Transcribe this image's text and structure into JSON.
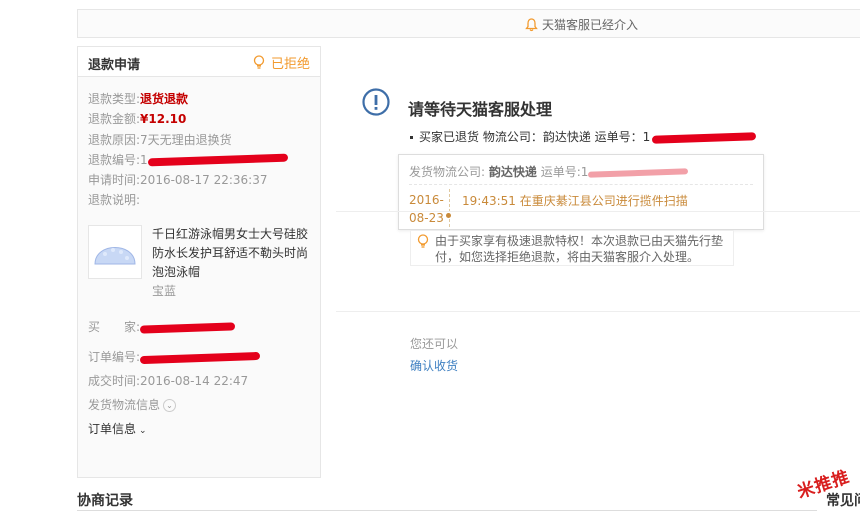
{
  "notice": {
    "text": "天猫客服已经介入",
    "icon": "bell-icon"
  },
  "refund_panel": {
    "title": "退款申请",
    "status": "已拒绝",
    "rows": [
      {
        "label": "退款类型:",
        "value": "退货退款"
      },
      {
        "label": "退款金额:",
        "value": "¥12.10"
      },
      {
        "label": "退款原因:",
        "value": "7天无理由退换货"
      },
      {
        "label": "退款编号:",
        "value": "1"
      },
      {
        "label": "申请时间:",
        "value": "2016-08-17 22:36:37"
      },
      {
        "label": "退款说明:",
        "value": ""
      }
    ],
    "product": {
      "name": "千日红游泳帽男女士大号硅胶防水长发护耳舒适不勒头时尚泡泡泳帽",
      "shop": "宝蓝"
    },
    "buyer_label": "买　　家:",
    "order_no_label": "订单编号:",
    "deal_time_label": "成交时间:",
    "deal_time": "2016-08-14 22:47",
    "shipping_info": "发货物流信息",
    "order_info": "订单信息"
  },
  "main": {
    "title": "请等待天猫客服处理",
    "line": "买家已退货 物流公司：韵达快递 运单号：1",
    "popup": {
      "company_label": "发货物流公司:",
      "company": "韵达快递",
      "waybill_label": "运单号:",
      "waybill": "1",
      "date_line1": "2016-",
      "date_line2": "08-23",
      "event": "19:43:51  在重庆綦江县公司进行揽件扫描"
    },
    "tip_line1": "由于买家享有极速退款特权！本次退款已由天猫先行垫",
    "tip_line2": "付，如您选择拒绝退款，将由天猫客服介入处理。",
    "also_can": "您还可以",
    "confirm_receipt": "确认收货"
  },
  "bottom": {
    "left": "协商记录",
    "right": "常见问"
  },
  "watermark": "米推推",
  "colors": {
    "accent_red": "#c40000",
    "status_orange": "#f29a2e",
    "link_blue": "#3d7fc1",
    "redaction": "#e4001b"
  }
}
